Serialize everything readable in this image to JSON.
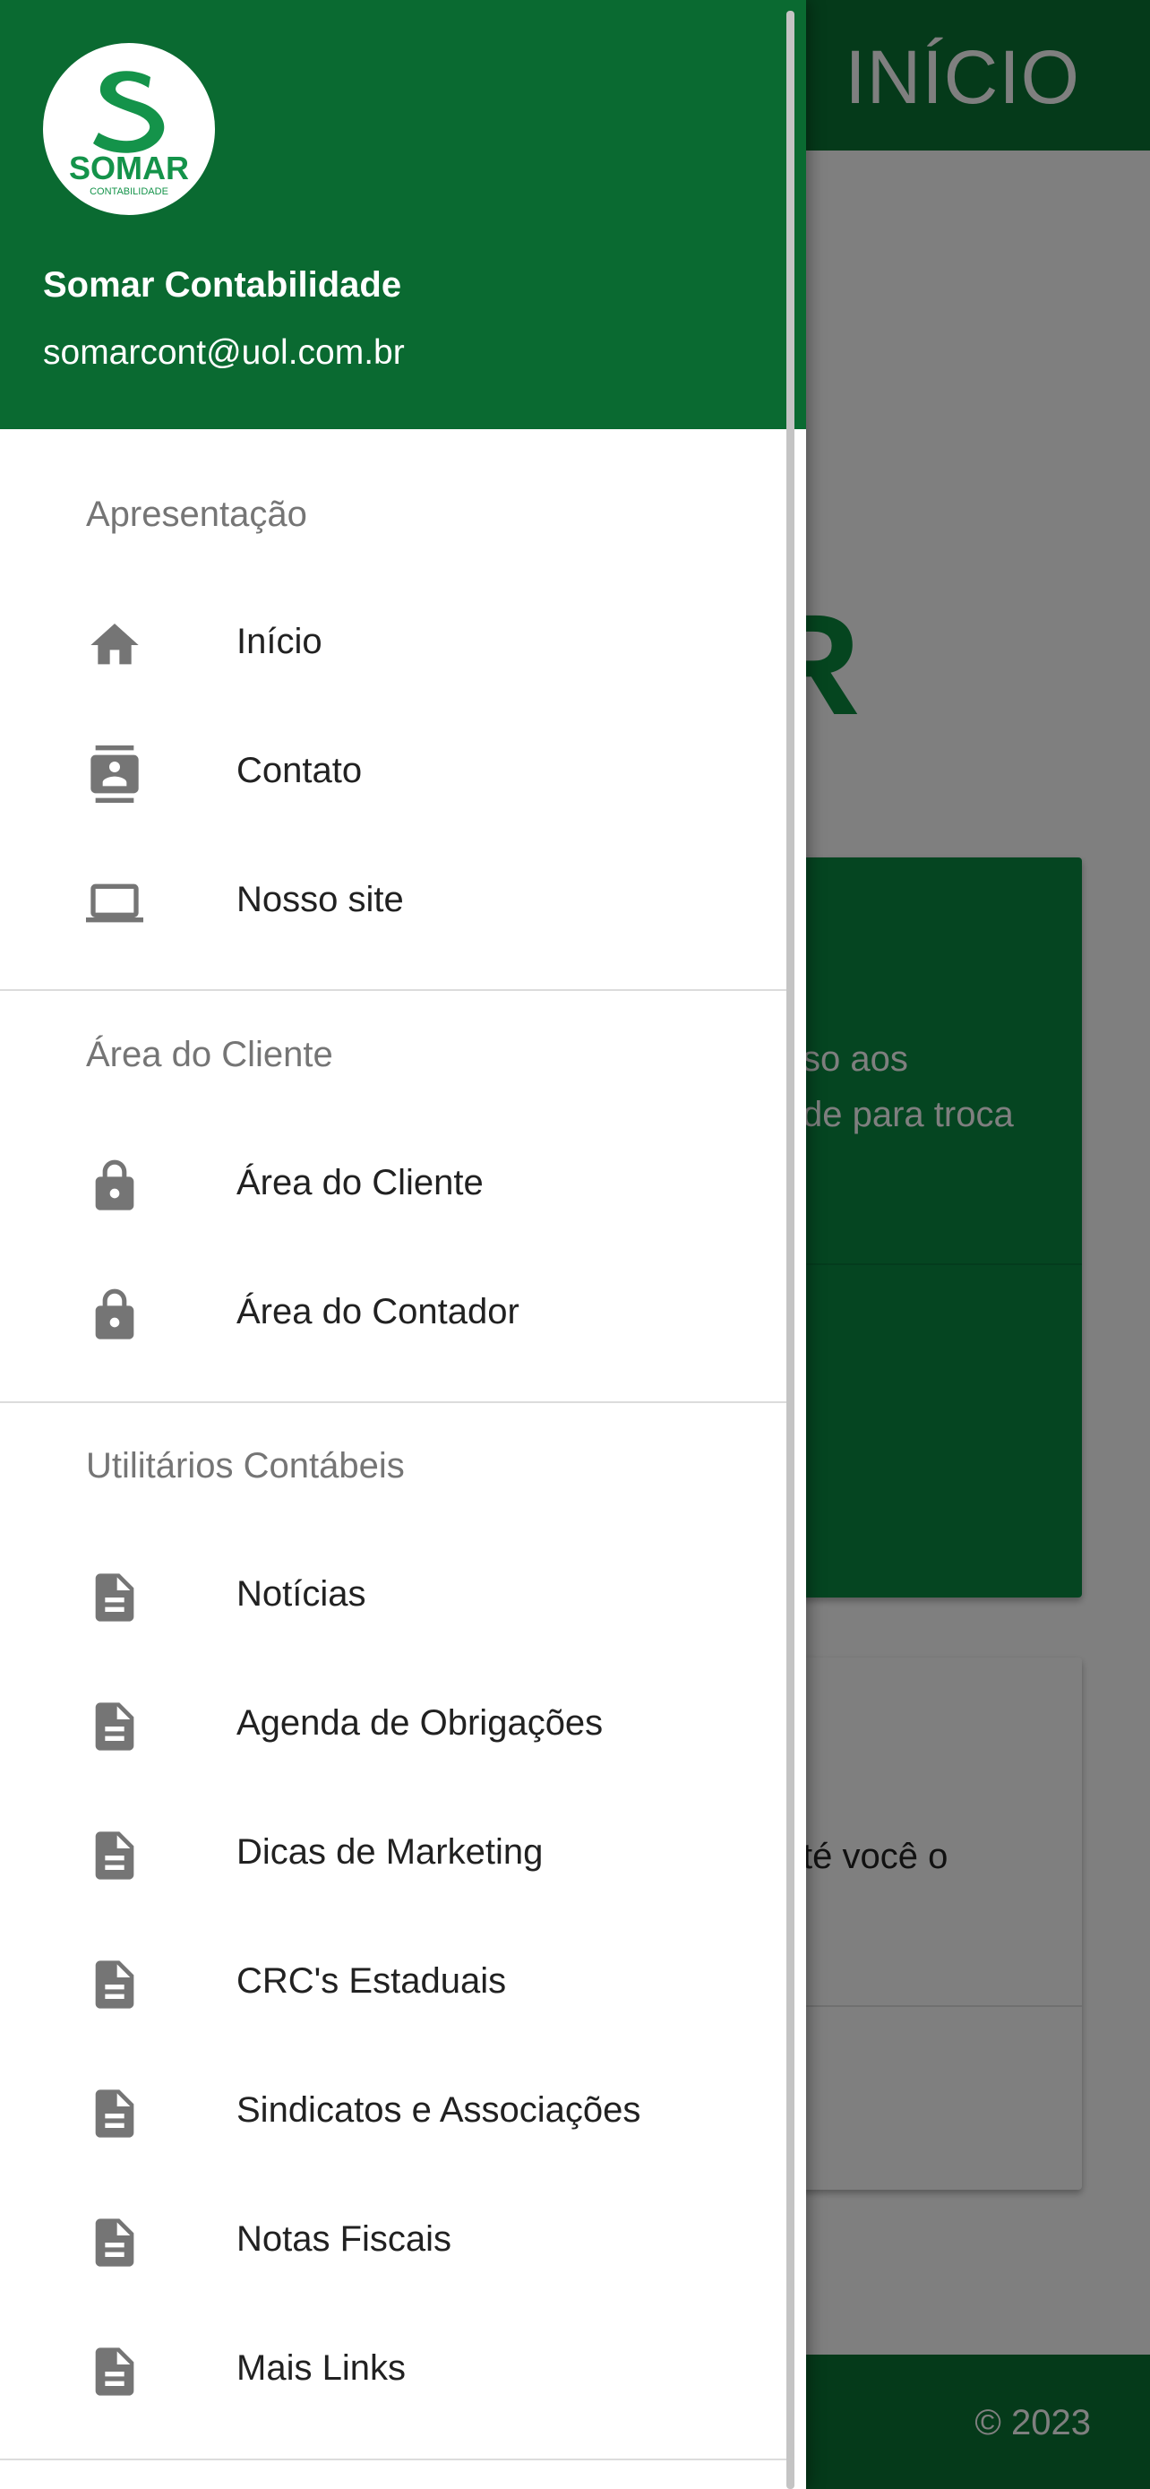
{
  "background": {
    "appbar_title": "INÍCIO",
    "logo_fragment": "R",
    "card1_lines": [
      "so aos",
      "de para troca"
    ],
    "card2_line": "té você o",
    "footer": "© 2023"
  },
  "drawer": {
    "header": {
      "logo_text": "SOMAR",
      "logo_subtext": "CONTABILIDADE",
      "name": "Somar Contabilidade",
      "email": "somarcont@uol.com.br"
    },
    "sections": [
      {
        "title": "Apresentação",
        "items": [
          {
            "label": "Início",
            "icon": "home-icon"
          },
          {
            "label": "Contato",
            "icon": "contact-icon"
          },
          {
            "label": "Nosso site",
            "icon": "laptop-icon"
          }
        ]
      },
      {
        "title": "Área do Cliente",
        "items": [
          {
            "label": "Área do Cliente",
            "icon": "lock-icon"
          },
          {
            "label": "Área do Contador",
            "icon": "lock-icon"
          }
        ]
      },
      {
        "title": "Utilitários Contábeis",
        "items": [
          {
            "label": "Notícias",
            "icon": "document-icon"
          },
          {
            "label": "Agenda de Obrigações",
            "icon": "document-icon"
          },
          {
            "label": "Dicas de Marketing",
            "icon": "document-icon"
          },
          {
            "label": "CRC's Estaduais",
            "icon": "document-icon"
          },
          {
            "label": "Sindicatos e Associações",
            "icon": "document-icon"
          },
          {
            "label": "Notas Fiscais",
            "icon": "document-icon"
          },
          {
            "label": "Mais Links",
            "icon": "document-icon"
          }
        ]
      }
    ]
  },
  "colors": {
    "brand_green": "#0a6a31",
    "icon_gray": "#757575",
    "scrim": "#000000"
  }
}
